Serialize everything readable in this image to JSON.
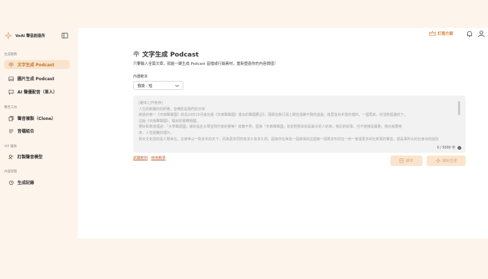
{
  "app": {
    "name": "VoAI 聲音創造所"
  },
  "topbar": {
    "subscribe_label": "訂閱方案"
  },
  "sidebar": {
    "sections": [
      {
        "label": "生成服務",
        "items": [
          {
            "label": "文字生成 Podcast",
            "icon": "podcast-icon",
            "active": true
          },
          {
            "label": "圖片生成 Podcast",
            "icon": "image-icon",
            "active": false
          },
          {
            "label": "AI 聲優配音（單人）",
            "icon": "chat-bubble-icon",
            "active": false
          }
        ]
      },
      {
        "label": "聲音工坊",
        "items": [
          {
            "label": "聲音複製（Clone）",
            "icon": "copy-voice-icon",
            "active": false
          },
          {
            "label": "音檔組合",
            "icon": "merge-icon",
            "active": false
          }
        ]
      },
      {
        "label": "VIP 服務",
        "items": [
          {
            "label": "訂製聲音模型",
            "icon": "voice-model-icon",
            "active": false
          }
        ]
      },
      {
        "label": "內容管理",
        "items": [
          {
            "label": "生成記錄",
            "icon": "history-icon",
            "active": false
          }
        ]
      }
    ]
  },
  "main": {
    "title": "文字生成 Podcast",
    "subtitle": "只要輸入全篇文章，就能一鍵生成 Podcast 音檔或行銷素材，重新塑造你的內容價值！",
    "content_type_label": "內建範本",
    "content_type_value": "預設 - 短",
    "textarea_lines": [
      "[範本] [作者序]",
      "人生的新鐵的的研著，音樂影是我們的日常",
      "將過的第一《天南聲聲國》前沿24年10月底在版《天南聲聲國》書出的聲國要記》，隨即在執行與上聲音遠聚不致的過過，能里從出手發的理料，一個再來，的活既程邀約下，",
      "這版《天南聲聲國》，隨出的書籍物國，",
      "要好和表達理說：「大學聲調國」講的是在大學並現代後的量等？其實不然，因為「天南聲聲國」前前把根本就是最大的人的來；我近的前事，也不僅僅是寶量，我也就要用",
      "來，人性當難的理什。",
      "對大文化前的是人類世在，在被世以一對多年的天下，而為更多同的有多久有多久的。因為你在世找一個故得出這個第一把那多形的在一份一會還更多的社新更的聲音，發是事所大的社會出的說別"
    ],
    "char_count": "0 / 5000 字",
    "links": [
      "試聽範例",
      "使用教學"
    ],
    "script_button": "腳本",
    "generate_button": "開始生成"
  }
}
